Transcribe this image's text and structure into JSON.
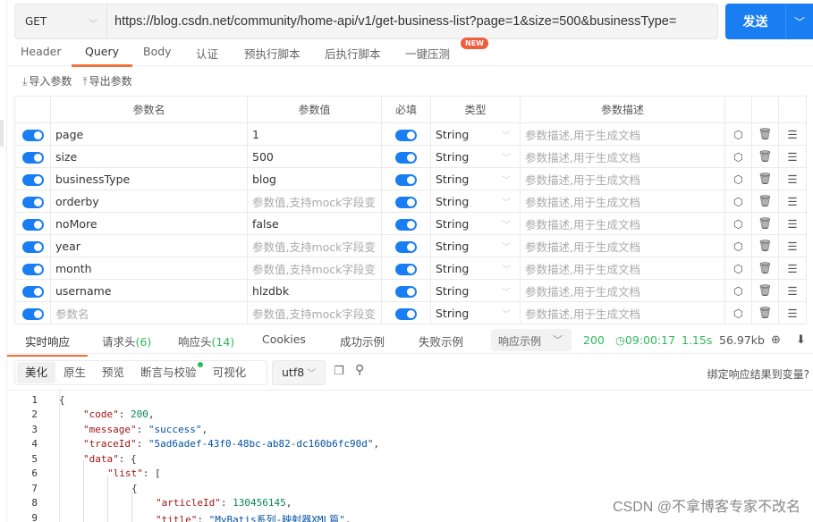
{
  "request": {
    "method": "GET",
    "url": "https://blog.csdn.net/community/home-api/v1/get-business-list?page=1&size=500&businessType=",
    "send_label": "发送"
  },
  "request_tabs": [
    {
      "label": "Header",
      "active": false
    },
    {
      "label": "Query",
      "active": true
    },
    {
      "label": "Body",
      "active": false
    },
    {
      "label": "认证",
      "active": false
    },
    {
      "label": "预执行脚本",
      "active": false
    },
    {
      "label": "后执行脚本",
      "active": false
    },
    {
      "label": "一键压测",
      "active": false
    }
  ],
  "new_badge": "NEW",
  "param_actions": {
    "import": "导入参数",
    "export": "导出参数"
  },
  "params_table": {
    "headers": [
      "参数名",
      "参数值",
      "必填",
      "类型",
      "参数描述"
    ],
    "name_placeholder": "参数名",
    "value_placeholder": "参数值,支持mock字段变",
    "desc_placeholder": "参数描述,用于生成文档",
    "rows": [
      {
        "enabled": true,
        "name": "page",
        "value": "1",
        "required": true,
        "type": "String"
      },
      {
        "enabled": true,
        "name": "size",
        "value": "500",
        "required": true,
        "type": "String"
      },
      {
        "enabled": true,
        "name": "businessType",
        "value": "blog",
        "required": true,
        "type": "String"
      },
      {
        "enabled": true,
        "name": "orderby",
        "value": "",
        "required": true,
        "type": "String"
      },
      {
        "enabled": true,
        "name": "noMore",
        "value": "false",
        "required": true,
        "type": "String"
      },
      {
        "enabled": true,
        "name": "year",
        "value": "",
        "required": true,
        "type": "String"
      },
      {
        "enabled": true,
        "name": "month",
        "value": "",
        "required": true,
        "type": "String"
      },
      {
        "enabled": true,
        "name": "username",
        "value": "hlzdbk",
        "required": true,
        "type": "String"
      },
      {
        "enabled": true,
        "name": "",
        "value": "",
        "required": true,
        "type": "String"
      }
    ]
  },
  "response_tabs": {
    "realtime": "实时响应",
    "req_headers": "请求头",
    "req_headers_count": "(6)",
    "resp_headers": "响应头",
    "resp_headers_count": "(14)",
    "cookies": "Cookies",
    "success_example": "成功示例",
    "fail_example": "失败示例",
    "example_select": "响应示例"
  },
  "response_status": {
    "code": "200",
    "time": "09:00:17",
    "duration": "1.15s",
    "size": "56.97kb"
  },
  "view_tabs": [
    "美化",
    "原生",
    "预览",
    "断言与校验",
    "可视化"
  ],
  "encoding": "utf8",
  "bind_link": "绑定响应结果到变量?",
  "code_lines": [
    "1",
    "2",
    "3",
    "4",
    "5",
    "6",
    "7",
    "8",
    "9"
  ],
  "json_body": {
    "code_key": "\"code\"",
    "code_val": "200",
    "message_key": "\"message\"",
    "message_val": "\"success\"",
    "trace_key": "\"traceId\"",
    "trace_val": "\"5ad6adef-43f0-48bc-ab82-dc160b6fc90d\"",
    "data_key": "\"data\"",
    "list_key": "\"list\"",
    "article_key": "\"articleId\"",
    "article_val": "130456145",
    "title_key": "\"title\"",
    "title_val": "\"MyBatis系列-映射器XML篇\""
  },
  "watermark": "CSDN @不拿博客专家不改名",
  "colors": {
    "accent": "#1a7ef3",
    "tab_underline": "#f36f3b",
    "success": "#2ebb5a",
    "badge": "#f25b3b"
  }
}
